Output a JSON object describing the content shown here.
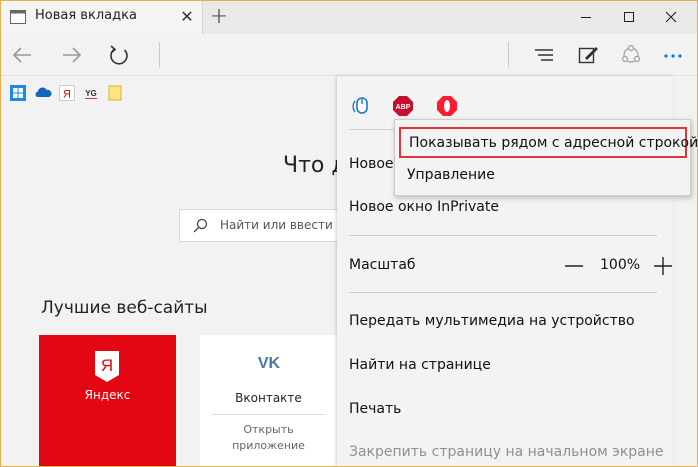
{
  "tab": {
    "title": "Новая вкладка",
    "close_glyph": "✕"
  },
  "new_tab_glyph": "+",
  "window_controls": {
    "minimize": "minimize-icon",
    "maximize": "maximize-icon",
    "close": "close-icon"
  },
  "nav": {
    "back_icon": "back-arrow-icon",
    "forward_icon": "forward-arrow-icon",
    "refresh_icon": "refresh-icon",
    "hub_icon": "hub-icon",
    "note_icon": "web-note-icon",
    "share_icon": "share-icon",
    "more_icon": "more-icon"
  },
  "favorites": [
    "windows-icon",
    "onedrive-icon",
    "yandex-icon",
    "yg-icon",
    "folder-icon"
  ],
  "favorites_yg_text": "YG",
  "favorites_ya_text": "Я",
  "page": {
    "heading": "Что д",
    "search_placeholder": "Найти или ввести в",
    "top_sites_title": "Лучшие веб-сайты",
    "tiles": [
      {
        "label": "Яндекс",
        "logo_text": "Я",
        "color": "#e30613"
      },
      {
        "label": "Вконтакте",
        "sub": "Открыть приложение",
        "logo_text": "VK"
      }
    ]
  },
  "menu": {
    "extensions": [
      "mouse-gesture-icon",
      "adblock-plus-icon",
      "opera-icon"
    ],
    "abp_text": "ABP",
    "items": {
      "new_window": "Новое",
      "inprivate": "Новое окно InPrivate",
      "zoom_label": "Масштаб",
      "zoom_value": "100%",
      "cast": "Передать мультимедиа на устройство",
      "find": "Найти на странице",
      "print": "Печать",
      "pin": "Закрепить страницу на начальном экране"
    }
  },
  "popup": {
    "show_next_to_address": "Показывать рядом с адресной строкой",
    "manage": "Управление"
  },
  "colors": {
    "accent": "#0078d7",
    "highlight_border": "#d9363e",
    "yandex": "#e30613",
    "abp": "#c70d2c",
    "opera": "#ff1b2d"
  }
}
